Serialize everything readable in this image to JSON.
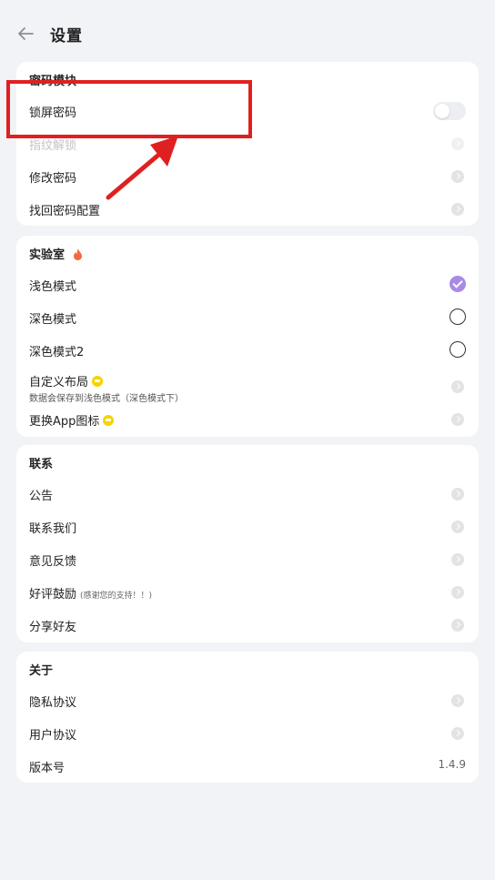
{
  "header": {
    "title": "设置",
    "back_icon": "arrow-left-icon"
  },
  "password_section": {
    "title": "密码模块",
    "items": [
      {
        "label": "锁屏密码",
        "control": "toggle",
        "state": "off"
      },
      {
        "label": "指纹解锁",
        "control": "toggle",
        "state": "disabled"
      },
      {
        "label": "修改密码",
        "control": "chevron"
      },
      {
        "label": "找回密码配置",
        "control": "chevron"
      }
    ]
  },
  "lab_section": {
    "title": "实验室",
    "title_icon": "fire-icon",
    "items": [
      {
        "label": "浅色模式",
        "control": "radio",
        "selected": true
      },
      {
        "label": "深色模式",
        "control": "radio",
        "selected": false
      },
      {
        "label": "深色模式2",
        "control": "radio",
        "selected": false
      },
      {
        "label": "自定义布局",
        "badge": "vip-icon",
        "sub": "数据会保存到浅色模式（深色模式下）",
        "control": "chevron"
      },
      {
        "label": "更换App图标",
        "badge": "vip-icon",
        "control": "chevron"
      }
    ]
  },
  "contact_section": {
    "title": "联系",
    "items": [
      {
        "label": "公告"
      },
      {
        "label": "联系我们"
      },
      {
        "label": "意见反馈"
      },
      {
        "label": "好评鼓励",
        "hint": "(感谢您的支持！！)"
      },
      {
        "label": "分享好友"
      }
    ]
  },
  "about_section": {
    "title": "关于",
    "items": [
      {
        "label": "隐私协议"
      },
      {
        "label": "用户协议"
      },
      {
        "label": "版本号",
        "value": "1.4.9"
      }
    ]
  },
  "colors": {
    "background": "#f2f3f7",
    "accent": "#a98be6",
    "annotation": "#e02020",
    "badge": "#f5d400"
  }
}
